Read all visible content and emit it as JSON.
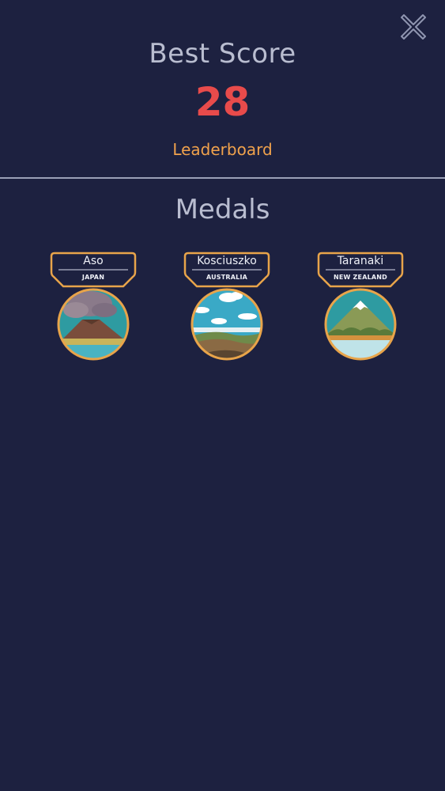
{
  "header": {
    "best_score_label": "Best Score",
    "best_score_value": "28",
    "leaderboard_label": "Leaderboard"
  },
  "medals_section": {
    "title": "Medals",
    "items": [
      {
        "name": "Aso",
        "country": "JAPAN"
      },
      {
        "name": "Kosciuszko",
        "country": "AUSTRALIA"
      },
      {
        "name": "Taranaki",
        "country": "NEW ZEALAND"
      }
    ]
  },
  "colors": {
    "background": "#1d2140",
    "score": "#e84b4b",
    "accent_orange": "#f1a24c",
    "title_text": "#b9bdd0",
    "medal_frame": "#e8a44a"
  },
  "icons": {
    "close": "close-icon"
  }
}
